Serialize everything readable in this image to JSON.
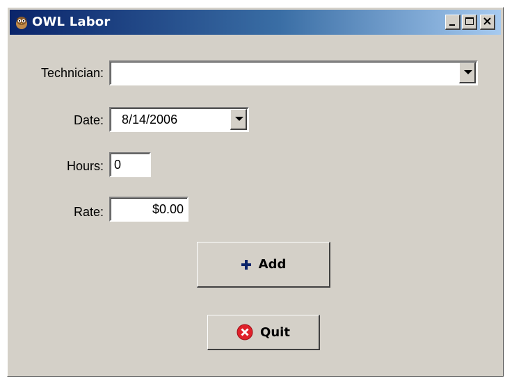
{
  "window": {
    "title": "OWL Labor",
    "controls": {
      "minimize": "minimize",
      "maximize": "maximize",
      "close": "close"
    }
  },
  "form": {
    "technician": {
      "label": "Technician:",
      "value": ""
    },
    "date": {
      "label": "Date:",
      "value": "8/14/2006"
    },
    "hours": {
      "label": "Hours:",
      "value": "0"
    },
    "rate": {
      "label": "Rate:",
      "value": "$0.00"
    }
  },
  "buttons": {
    "add": {
      "label": "Add",
      "icon": "plus-icon"
    },
    "quit": {
      "label": "Quit",
      "icon": "close-circle-icon"
    }
  },
  "colors": {
    "title_gradient_start": "#0a246a",
    "title_gradient_end": "#a6caf0",
    "face": "#d4d0c8",
    "plus_icon": "#0a246a",
    "quit_icon": "#e0202a"
  }
}
